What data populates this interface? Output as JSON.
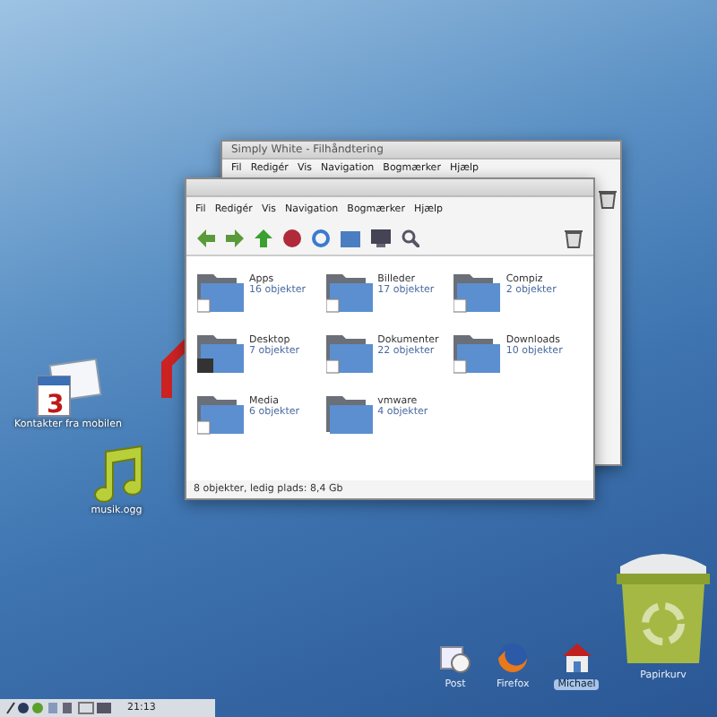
{
  "desktop_icons": [
    {
      "kind": "contacts",
      "label": "Kontakter fra mobilen",
      "calendar_day": "3"
    },
    {
      "kind": "music",
      "label": "musik.ogg"
    },
    {
      "kind": "home"
    }
  ],
  "back_window": {
    "title": "Simply White - Filhåndtering",
    "menu": [
      "Fil",
      "Redigér",
      "Vis",
      "Navigation",
      "Bogmærker",
      "Hjælp"
    ]
  },
  "front_window": {
    "menu": [
      "Fil",
      "Redigér",
      "Vis",
      "Navigation",
      "Bogmærker",
      "Hjælp"
    ],
    "folders": [
      {
        "name": "Apps",
        "count": "16 objekter",
        "kind": "link"
      },
      {
        "name": "Billeder",
        "count": "17 objekter",
        "kind": "link"
      },
      {
        "name": "Compiz",
        "count": "2 objekter",
        "kind": "link"
      },
      {
        "name": "Desktop",
        "count": "7 objekter",
        "kind": "desktop"
      },
      {
        "name": "Dokumenter",
        "count": "22 objekter",
        "kind": "link"
      },
      {
        "name": "Downloads",
        "count": "10 objekter",
        "kind": "link"
      },
      {
        "name": "Media",
        "count": "6 objekter",
        "kind": "link"
      },
      {
        "name": "vmware",
        "count": "4 objekter",
        "kind": "plain"
      }
    ],
    "status": "8 objekter, ledig plads: 8,4 Gb"
  },
  "dock": [
    {
      "kind": "mail",
      "label": "Post",
      "selected": false
    },
    {
      "kind": "firefox",
      "label": "Firefox",
      "selected": false
    },
    {
      "kind": "home",
      "label": "Michael",
      "selected": true
    }
  ],
  "trash": {
    "label": "Papirkurv"
  },
  "taskbar": {
    "clock": "21:13"
  }
}
